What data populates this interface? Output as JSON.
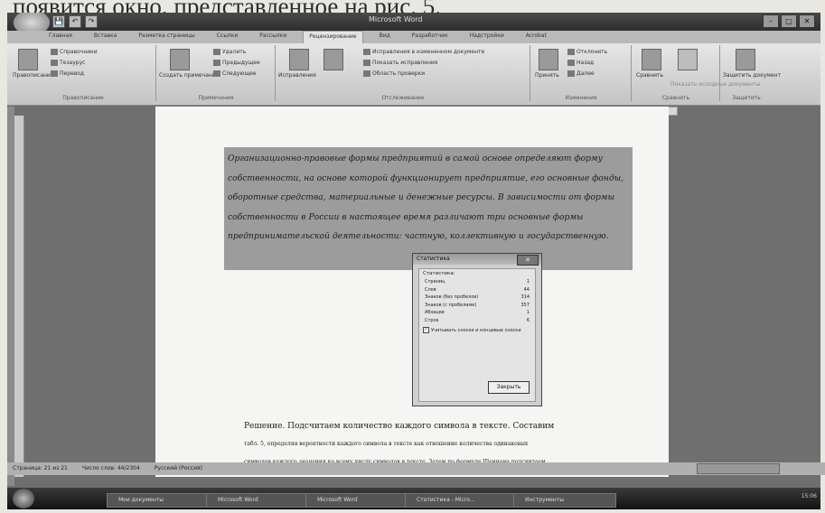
{
  "caption": "появится окно, представленное на рис. 5.",
  "window": {
    "title": "Microsoft Word",
    "controls": [
      "–",
      "□",
      "✕"
    ]
  },
  "quick_access": [
    "💾",
    "↶",
    "↷"
  ],
  "tabs": [
    "Главная",
    "Вставка",
    "Разметка страницы",
    "Ссылки",
    "Рассылки",
    "Рецензирование",
    "Вид",
    "Разработчик",
    "Надстройки",
    "Acrobat"
  ],
  "ribbon": {
    "groups": [
      {
        "name": "Правописание",
        "items": [
          "Правописание",
          "Справочники",
          "Тезаурус",
          "Перевод"
        ]
      },
      {
        "name": "Примечания",
        "items": [
          "Создать примечание",
          "Удалить",
          "Предыдущее",
          "Следующее"
        ]
      },
      {
        "name": "Отслеживание",
        "items": [
          "Исправления",
          "Исправления в измененном документе",
          "Показать исправления",
          "Область проверки"
        ]
      },
      {
        "name": "Изменения",
        "items": [
          "Принять",
          "Отклонить",
          "Назад",
          "Далее"
        ]
      },
      {
        "name": "Сравнить",
        "items": [
          "Сравнить",
          "Показать исходные документы"
        ]
      },
      {
        "name": "Защитить",
        "items": [
          "Защитить документ"
        ]
      }
    ]
  },
  "document": {
    "selected_paragraph": "Организационно-правовые формы предприятий в самой основе определяют форму собственности, на основе которой функционирует предприятие, его основные фонды, оборотные средства, материальные и денежные ресурсы. В зависимости от формы собственности в России в настоящее время различают три основные формы предпринимательской деятельности: частную, коллективную и государственную.",
    "after_line1": "Решение. Подсчитаем количество каждого символа в тексте. Составим",
    "after_line2": "табл. 5, определяя вероятности каждого символа в тексте как отношение количества одинаковых",
    "after_line3": "символов каждого значения ко всему числу символов в тексте. Затем по формуле Шеннона подсчитаем"
  },
  "dialog": {
    "title": "Статистика",
    "close": "✕",
    "section": "Статистика:",
    "rows": [
      {
        "label": "Страниц",
        "value": "1"
      },
      {
        "label": "Слов",
        "value": "44"
      },
      {
        "label": "Знаков (без пробелов)",
        "value": "314"
      },
      {
        "label": "Знаков (с пробелами)",
        "value": "357"
      },
      {
        "label": "Абзацев",
        "value": "1"
      },
      {
        "label": "Строк",
        "value": "6"
      }
    ],
    "checkbox": "Учитывать сноски и концевые сноски",
    "button": "Закрыть"
  },
  "statusbar": {
    "page": "Страница: 21 из 21",
    "words": "Число слов: 44/2304",
    "lang": "Русский (Россия)"
  },
  "taskbar": {
    "tasks": [
      "Мои документы",
      "Microsoft Word",
      "Microsoft Word",
      "Статистика - Micro...",
      "Инструменты"
    ],
    "clock": "15:06"
  }
}
